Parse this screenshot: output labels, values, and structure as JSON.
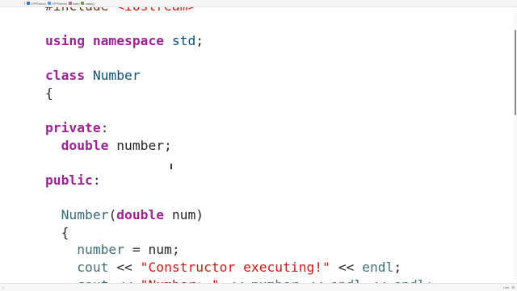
{
  "titlebar": {
    "breadcrumbs": [
      {
        "label": "CPPDemo",
        "icon": "project-icon"
      },
      {
        "label": "CPPDemo",
        "icon": "folder-icon"
      },
      {
        "label": "main",
        "icon": "cpp-file-icon"
      },
      {
        "label": "main()",
        "icon": "function-icon"
      }
    ]
  },
  "code_lines": [
    [
      {
        "t": "#include ",
        "c": "pre"
      },
      {
        "t": "<iostream>",
        "c": "pstr"
      }
    ],
    [],
    [
      {
        "t": "using",
        "c": "kw"
      },
      {
        "t": " "
      },
      {
        "t": "namespace",
        "c": "kw"
      },
      {
        "t": " "
      },
      {
        "t": "std",
        "c": "ty"
      },
      {
        "t": ";"
      }
    ],
    [],
    [
      {
        "t": "class",
        "c": "kw"
      },
      {
        "t": " "
      },
      {
        "t": "Number",
        "c": "ty"
      }
    ],
    [
      {
        "t": "{"
      }
    ],
    [],
    [
      {
        "t": "private",
        "c": "kw"
      },
      {
        "t": ":"
      }
    ],
    [
      {
        "t": "  "
      },
      {
        "t": "double",
        "c": "kw"
      },
      {
        "t": " number;"
      }
    ],
    [],
    [
      {
        "t": "public",
        "c": "kw"
      },
      {
        "t": ":"
      }
    ],
    [],
    [
      {
        "t": "  "
      },
      {
        "t": "Number",
        "c": "fn"
      },
      {
        "t": "("
      },
      {
        "t": "double",
        "c": "kw"
      },
      {
        "t": " num)"
      }
    ],
    [
      {
        "t": "  {"
      }
    ],
    [
      {
        "t": "    "
      },
      {
        "t": "number",
        "c": "ctype"
      },
      {
        "t": " = num;"
      }
    ],
    [
      {
        "t": "    "
      },
      {
        "t": "cout",
        "c": "ctype"
      },
      {
        "t": " << "
      },
      {
        "t": "\"Constructor executing!\"",
        "c": "str"
      },
      {
        "t": " << "
      },
      {
        "t": "endl",
        "c": "ctype"
      },
      {
        "t": ";"
      }
    ],
    [
      {
        "t": "    "
      },
      {
        "t": "cout",
        "c": "ctype"
      },
      {
        "t": " << "
      },
      {
        "t": "\"Number: \"",
        "c": "str"
      },
      {
        "t": " << "
      },
      {
        "t": "number",
        "c": "ctype"
      },
      {
        "t": " << "
      },
      {
        "t": "endl",
        "c": "ctype"
      },
      {
        "t": " << "
      },
      {
        "t": "endl",
        "c": "ctype"
      },
      {
        "t": ";"
      }
    ]
  ],
  "statusbar": {
    "right_label": "Line"
  }
}
